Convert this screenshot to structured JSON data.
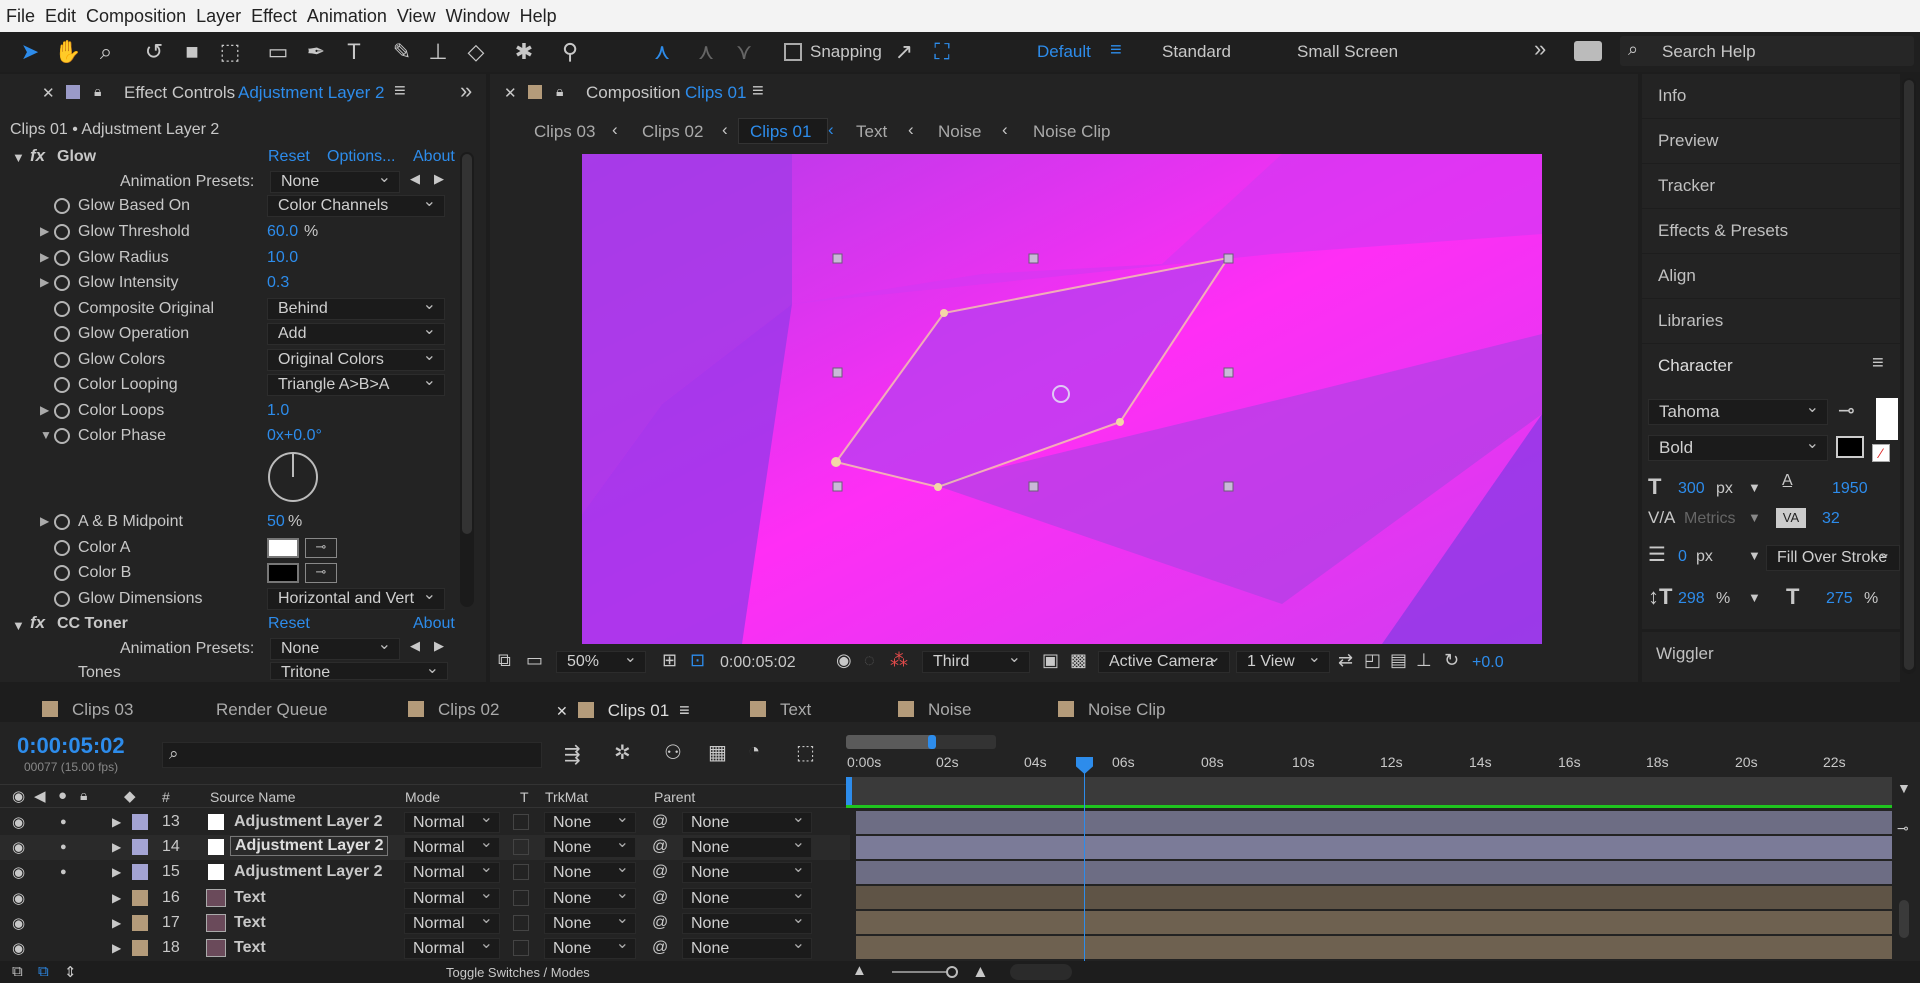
{
  "menu": [
    "File",
    "Edit",
    "Composition",
    "Layer",
    "Effect",
    "Animation",
    "View",
    "Window",
    "Help"
  ],
  "toolbar": {
    "snapping": "Snapping",
    "workspaces": [
      "Default",
      "Standard",
      "Small Screen"
    ],
    "search_placeholder": "Search Help"
  },
  "effect_panel": {
    "tab_prefix": "Effect Controls",
    "tab_layer": "Adjustment Layer 2",
    "subtitle": "Clips 01 • Adjustment Layer 2",
    "glow": {
      "name": "Glow",
      "reset": "Reset",
      "options": "Options...",
      "about": "About",
      "presets_label": "Animation Presets:",
      "presets_value": "None"
    },
    "props": [
      {
        "name": "Glow Based On",
        "dd": "Color Channels"
      },
      {
        "name": "Glow Threshold",
        "val": "60.0",
        "unit": "%"
      },
      {
        "name": "Glow Radius",
        "val": "10.0"
      },
      {
        "name": "Glow Intensity",
        "val": "0.3"
      },
      {
        "name": "Composite Original",
        "dd": "Behind"
      },
      {
        "name": "Glow Operation",
        "dd": "Add"
      },
      {
        "name": "Glow Colors",
        "dd": "Original Colors"
      },
      {
        "name": "Color Looping",
        "dd": "Triangle A>B>A"
      },
      {
        "name": "Color Loops",
        "val": "1.0"
      },
      {
        "name": "Color Phase",
        "val": "0x+0.0°"
      }
    ],
    "props2": [
      {
        "name": "A & B Midpoint",
        "val": "50",
        "unit": "%"
      },
      {
        "name": "Color A"
      },
      {
        "name": "Color B"
      },
      {
        "name": "Glow Dimensions",
        "dd": "Horizontal and Vert"
      }
    ],
    "toner": {
      "name": "CC Toner",
      "reset": "Reset",
      "about": "About",
      "presets_label": "Animation Presets:",
      "presets_value": "None",
      "tones_label": "Tones",
      "tones_value": "Tritone"
    }
  },
  "comp_panel": {
    "tab_prefix": "Composition",
    "tab_name": "Clips 01",
    "flow": [
      "Clips 03",
      "Clips 02",
      "Clips 01",
      "Text",
      "Noise",
      "Noise Clip"
    ],
    "zoom": "50%",
    "timecode": "0:00:05:02",
    "resolution": "Third",
    "camera": "Active Camera",
    "views": "1 View",
    "exposure": "+0.0"
  },
  "right_panel": {
    "items": [
      "Info",
      "Preview",
      "Tracker",
      "Effects & Presets",
      "Align",
      "Libraries"
    ],
    "character": "Character",
    "font": "Tahoma",
    "style": "Bold",
    "font_size": "300",
    "font_size_unit": "px",
    "leading": "1950",
    "kerning": "Metrics",
    "tracking": "32",
    "stroke_width": "0",
    "stroke_unit": "px",
    "stroke_mode": "Fill Over Stroke",
    "vscale": "298",
    "hscale": "275",
    "pct": "%",
    "wiggler": "Wiggler"
  },
  "timeline": {
    "tabs": [
      "Clips 03",
      "Render Queue",
      "Clips 02",
      "Clips 01",
      "Text",
      "Noise",
      "Noise Clip"
    ],
    "timecode": "0:00:05:02",
    "frames": "00077 (15.00 fps)",
    "headers": {
      "hash": "#",
      "source": "Source Name",
      "mode": "Mode",
      "t": "T",
      "trkmat": "TrkMat",
      "parent": "Parent"
    },
    "ruler": [
      "0:00s",
      "02s",
      "04s",
      "06s",
      "08s",
      "10s",
      "12s",
      "14s",
      "16s",
      "18s",
      "20s",
      "22s"
    ],
    "layers": [
      {
        "num": "13",
        "name": "Adjustment Layer 2",
        "mode": "Normal",
        "trk": "None",
        "parent": "None"
      },
      {
        "num": "14",
        "name": "Adjustment Layer 2",
        "mode": "Normal",
        "trk": "None",
        "parent": "None"
      },
      {
        "num": "15",
        "name": "Adjustment Layer 2",
        "mode": "Normal",
        "trk": "None",
        "parent": "None"
      },
      {
        "num": "16",
        "name": "Text",
        "mode": "Normal",
        "trk": "None",
        "parent": "None"
      },
      {
        "num": "17",
        "name": "Text",
        "mode": "Normal",
        "trk": "None",
        "parent": "None"
      },
      {
        "num": "18",
        "name": "Text",
        "mode": "Normal",
        "trk": "None",
        "parent": "None"
      }
    ],
    "toggle": "Toggle Switches / Modes"
  },
  "colors": {
    "accent": "#2d8ceb",
    "magenta": "#ff2ef5",
    "violet": "#9b3bf2"
  }
}
